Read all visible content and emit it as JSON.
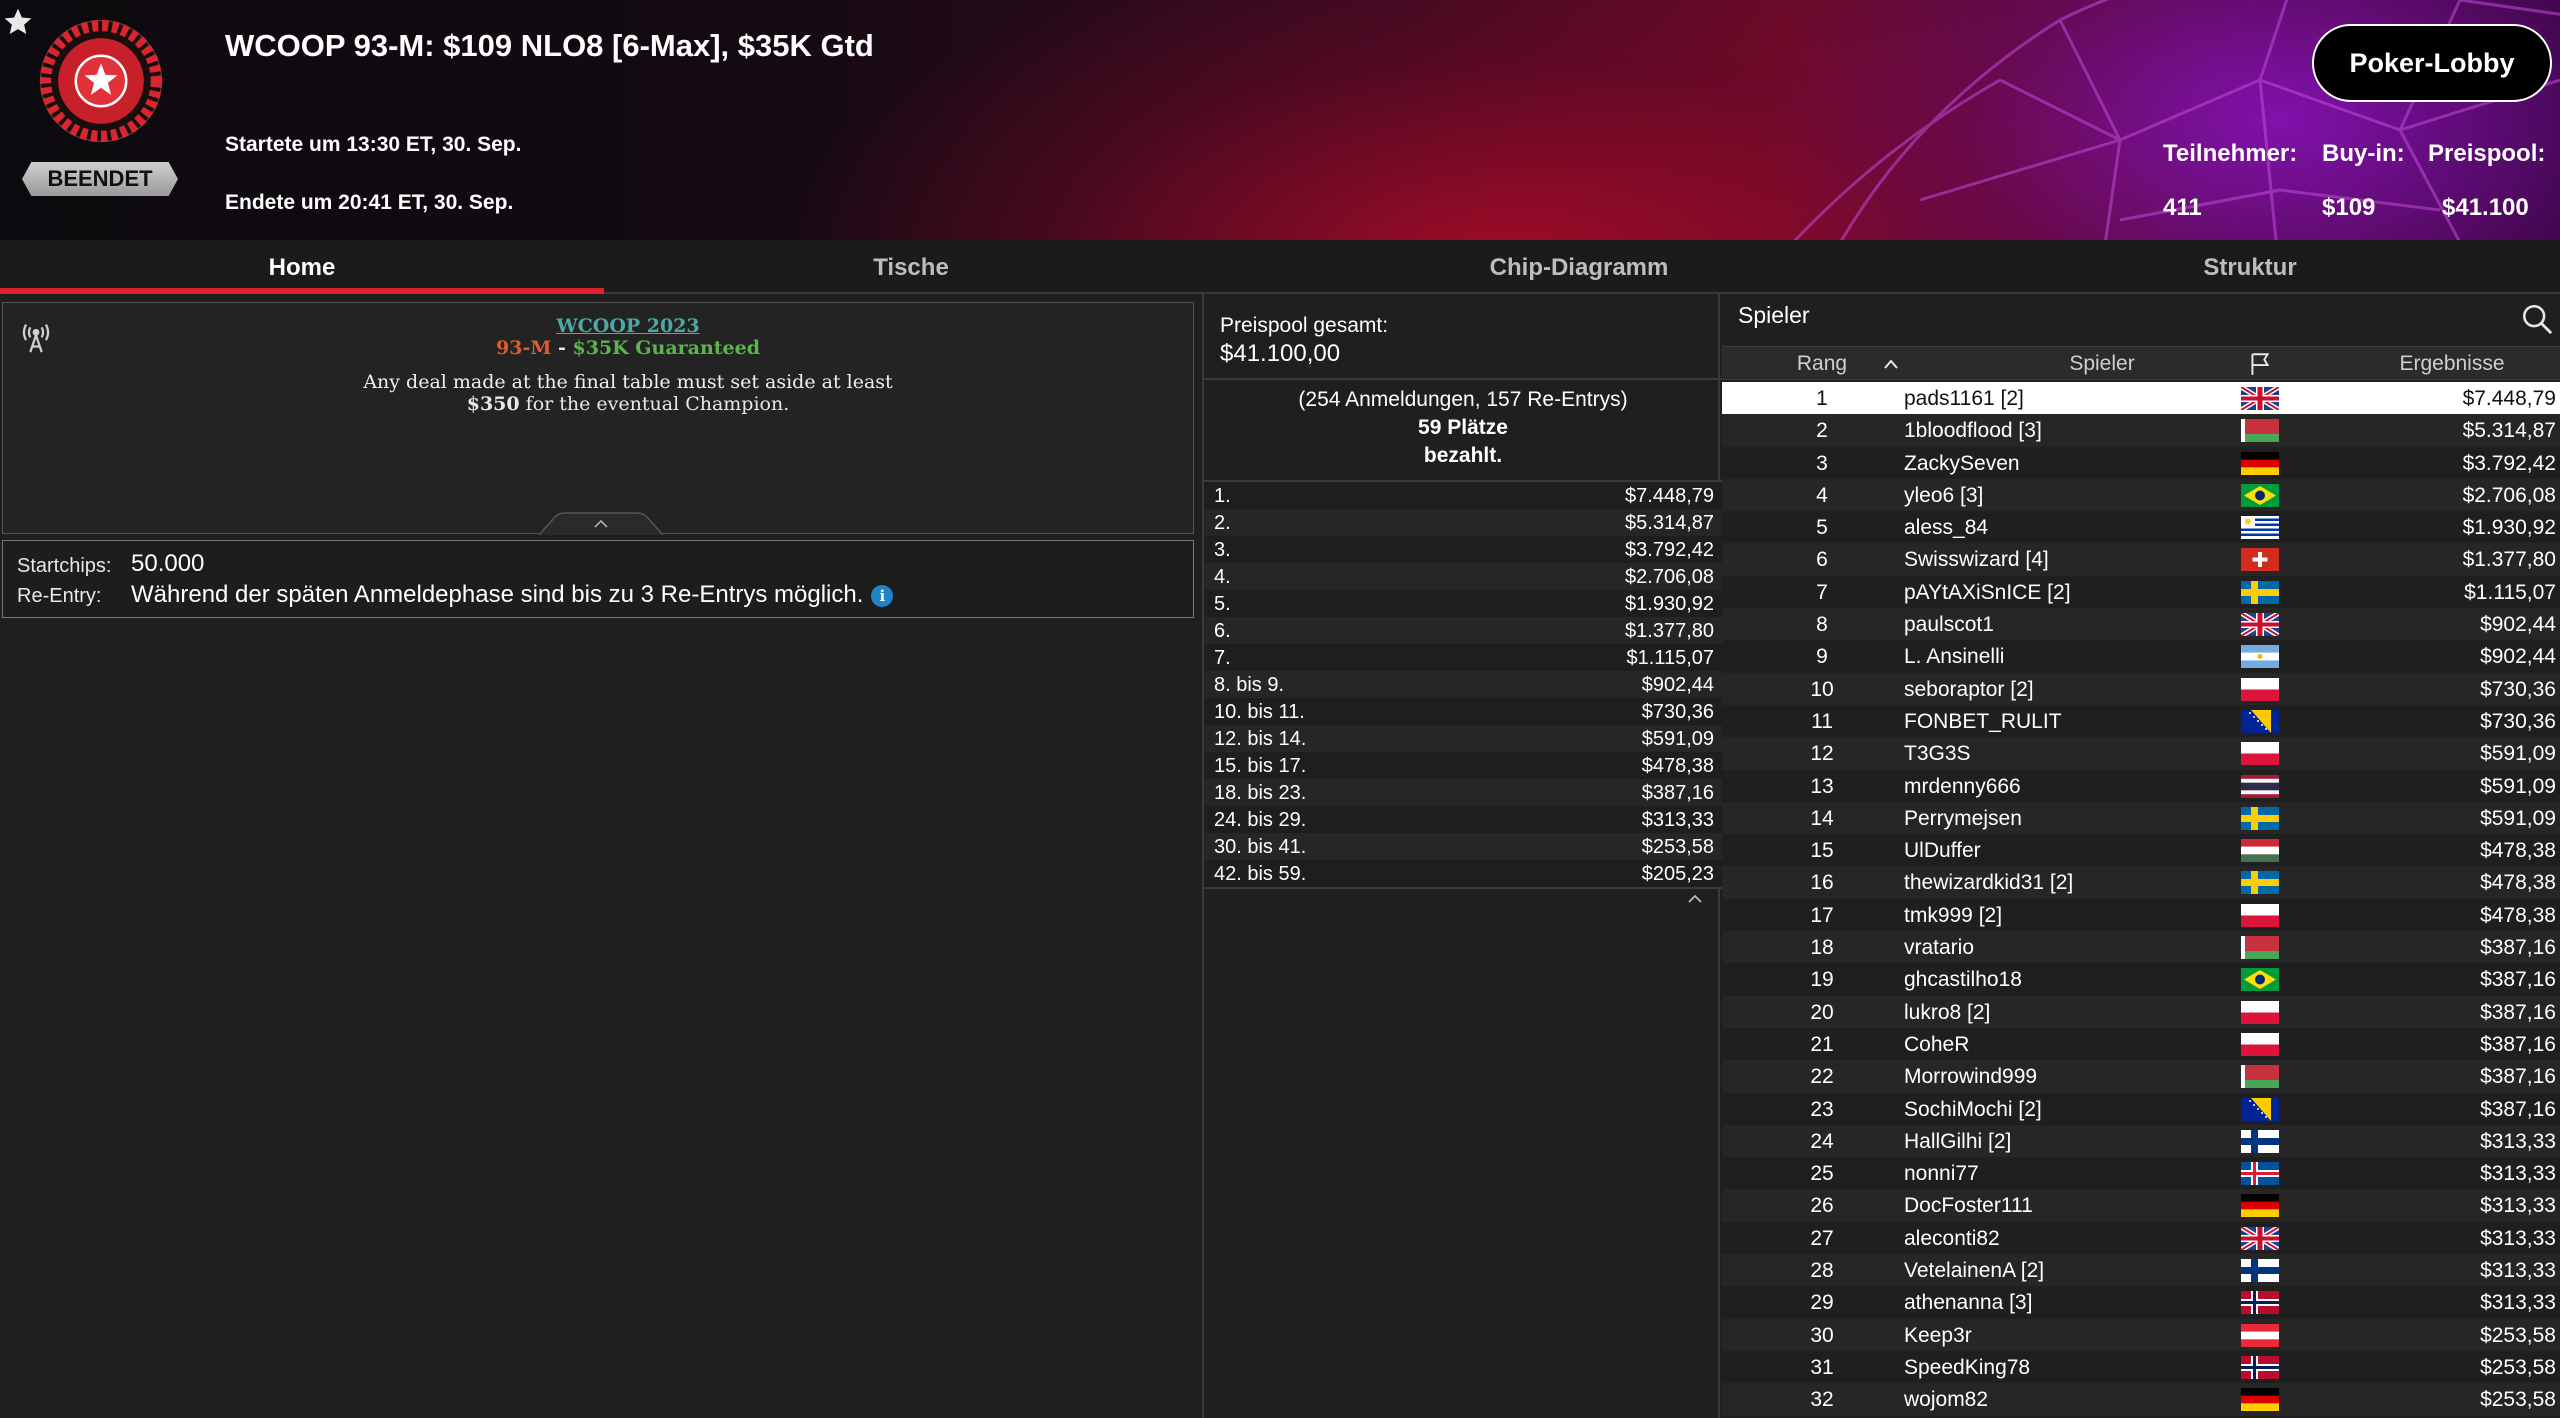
{
  "header": {
    "title": "WCOOP 93-M: $109 NLO8 [6-Max], $35K Gtd",
    "status": "BEENDET",
    "started": "Startete um 13:30 ET, 30. Sep.",
    "ended": "Endete um 20:41 ET, 30. Sep.",
    "lobby_button": "Poker-Lobby",
    "stats": {
      "participants_label": "Teilnehmer:",
      "participants_value": "411",
      "buyin_label": "Buy-in:",
      "buyin_value": "$109",
      "prizepool_label": "Preispool:",
      "prizepool_value": "$41.100"
    }
  },
  "tabs": [
    "Home",
    "Tische",
    "Chip-Diagramm",
    "Struktur"
  ],
  "info": {
    "line1": "WCOOP 2023",
    "line2_code": "93-M",
    "line2_sep": " - ",
    "line2_gtd": "$35K Guaranteed",
    "line3a": "Any deal made at the final table must set aside at least",
    "line3b_amount": "$350",
    "line3b_rest": " for the eventual Champion.",
    "startchips_label": "Startchips:",
    "startchips_value": "50.000",
    "reentry_label": "Re-Entry:",
    "reentry_value": "Während der späten Anmeldephase sind bis zu 3 Re-Entrys möglich.",
    "info_icon": "i"
  },
  "prizepool": {
    "label": "Preispool gesamt:",
    "value": "$41.100,00",
    "entries": "(254 Anmeldungen, 157 Re-Entrys)",
    "places": "59 Plätze",
    "paid": "bezahlt.",
    "payouts": [
      {
        "place": "1.",
        "amount": "$7.448,79"
      },
      {
        "place": "2.",
        "amount": "$5.314,87"
      },
      {
        "place": "3.",
        "amount": "$3.792,42"
      },
      {
        "place": "4.",
        "amount": "$2.706,08"
      },
      {
        "place": "5.",
        "amount": "$1.930,92"
      },
      {
        "place": "6.",
        "amount": "$1.377,80"
      },
      {
        "place": "7.",
        "amount": "$1.115,07"
      },
      {
        "place": "8. bis 9.",
        "amount": "$902,44"
      },
      {
        "place": "10. bis 11.",
        "amount": "$730,36"
      },
      {
        "place": "12. bis 14.",
        "amount": "$591,09"
      },
      {
        "place": "15. bis 17.",
        "amount": "$478,38"
      },
      {
        "place": "18. bis 23.",
        "amount": "$387,16"
      },
      {
        "place": "24. bis 29.",
        "amount": "$313,33"
      },
      {
        "place": "30. bis 41.",
        "amount": "$253,58"
      },
      {
        "place": "42. bis 59.",
        "amount": "$205,23"
      }
    ]
  },
  "players": {
    "title": "Spieler",
    "columns": {
      "rank": "Rang",
      "player": "Spieler",
      "result": "Ergebnisse"
    },
    "rows": [
      {
        "rank": "1",
        "name": "pads1161 [2]",
        "flag": "gb",
        "result": "$7.448,79"
      },
      {
        "rank": "2",
        "name": "1bloodflood [3]",
        "flag": "by",
        "result": "$5.314,87"
      },
      {
        "rank": "3",
        "name": "ZackySeven",
        "flag": "de",
        "result": "$3.792,42"
      },
      {
        "rank": "4",
        "name": "yleo6 [3]",
        "flag": "br",
        "result": "$2.706,08"
      },
      {
        "rank": "5",
        "name": "aless_84",
        "flag": "uy",
        "result": "$1.930,92"
      },
      {
        "rank": "6",
        "name": "Swisswizard [4]",
        "flag": "ch",
        "result": "$1.377,80"
      },
      {
        "rank": "7",
        "name": "pAYtAXiSnICE [2]",
        "flag": "se",
        "result": "$1.115,07"
      },
      {
        "rank": "8",
        "name": "paulscot1",
        "flag": "gb",
        "result": "$902,44"
      },
      {
        "rank": "9",
        "name": "L. Ansinelli",
        "flag": "ar",
        "result": "$902,44"
      },
      {
        "rank": "10",
        "name": "seboraptor [2]",
        "flag": "pl",
        "result": "$730,36"
      },
      {
        "rank": "11",
        "name": "FONBET_RULIT",
        "flag": "ba",
        "result": "$730,36"
      },
      {
        "rank": "12",
        "name": "T3G3S",
        "flag": "pl",
        "result": "$591,09"
      },
      {
        "rank": "13",
        "name": "mrdenny666",
        "flag": "th",
        "result": "$591,09"
      },
      {
        "rank": "14",
        "name": "Perrymejsen",
        "flag": "se",
        "result": "$591,09"
      },
      {
        "rank": "15",
        "name": "UlDuffer",
        "flag": "hu",
        "result": "$478,38"
      },
      {
        "rank": "16",
        "name": "thewizardkid31 [2]",
        "flag": "se",
        "result": "$478,38"
      },
      {
        "rank": "17",
        "name": "tmk999 [2]",
        "flag": "pl",
        "result": "$478,38"
      },
      {
        "rank": "18",
        "name": "vratario",
        "flag": "by",
        "result": "$387,16"
      },
      {
        "rank": "19",
        "name": "ghcastilho18",
        "flag": "br",
        "result": "$387,16"
      },
      {
        "rank": "20",
        "name": "lukro8 [2]",
        "flag": "pl",
        "result": "$387,16"
      },
      {
        "rank": "21",
        "name": "CoheR",
        "flag": "pl",
        "result": "$387,16"
      },
      {
        "rank": "22",
        "name": "Morrowind999",
        "flag": "by",
        "result": "$387,16"
      },
      {
        "rank": "23",
        "name": "SochiMochi [2]",
        "flag": "ba",
        "result": "$387,16"
      },
      {
        "rank": "24",
        "name": "HallGilhi [2]",
        "flag": "fi",
        "result": "$313,33"
      },
      {
        "rank": "25",
        "name": "nonni77",
        "flag": "is",
        "result": "$313,33"
      },
      {
        "rank": "26",
        "name": "DocFoster111",
        "flag": "de",
        "result": "$313,33"
      },
      {
        "rank": "27",
        "name": "aleconti82",
        "flag": "gb",
        "result": "$313,33"
      },
      {
        "rank": "28",
        "name": "VetelainenA [2]",
        "flag": "fi",
        "result": "$313,33"
      },
      {
        "rank": "29",
        "name": "athenanna [3]",
        "flag": "no",
        "result": "$313,33"
      },
      {
        "rank": "30",
        "name": "Keep3r",
        "flag": "at",
        "result": "$253,58"
      },
      {
        "rank": "31",
        "name": "SpeedKing78",
        "flag": "no",
        "result": "$253,58"
      },
      {
        "rank": "32",
        "name": "wojom82",
        "flag": "de",
        "result": "$253,58"
      }
    ]
  }
}
